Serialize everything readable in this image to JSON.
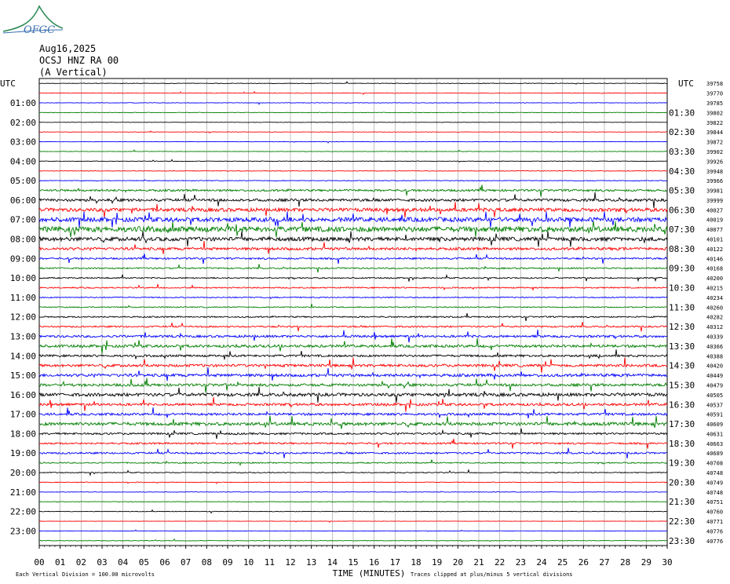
{
  "header": {
    "date": "Aug16,2025",
    "station": "OCSJ HNZ RA 00",
    "component": "(A Vertical)",
    "logo_text": "OFGC"
  },
  "axis": {
    "left_unit": "UTC",
    "right_unit": "UTC",
    "left_labels": [
      "01:00",
      "02:00",
      "03:00",
      "04:00",
      "05:00",
      "06:00",
      "07:00",
      "08:00",
      "09:00",
      "10:00",
      "11:00",
      "12:00",
      "13:00",
      "14:00",
      "15:00",
      "16:00",
      "17:00",
      "18:00",
      "19:00",
      "20:00",
      "21:00",
      "22:00",
      "23:00"
    ],
    "right_labels": [
      "01:30",
      "02:30",
      "03:30",
      "04:30",
      "05:30",
      "06:30",
      "07:30",
      "08:30",
      "09:30",
      "10:30",
      "11:30",
      "12:30",
      "13:30",
      "14:30",
      "15:30",
      "16:30",
      "17:30",
      "18:30",
      "19:30",
      "20:30",
      "21:30",
      "22:30",
      "23:30"
    ],
    "x_ticks": [
      "00",
      "01",
      "02",
      "03",
      "04",
      "05",
      "06",
      "07",
      "08",
      "09",
      "10",
      "11",
      "12",
      "13",
      "14",
      "15",
      "16",
      "17",
      "18",
      "19",
      "20",
      "21",
      "22",
      "23",
      "24",
      "25",
      "26",
      "27",
      "28",
      "29",
      "30"
    ],
    "x_title": "TIME (MINUTES)"
  },
  "footer": {
    "scale_note": "Each Vertical Division =  100.00 microvolts",
    "clip_note": "Traces clipped at plus/minus 5 vertical divisions"
  },
  "chart_data": {
    "type": "helicorder",
    "x_range_minutes": [
      0,
      30
    ],
    "trace_count": 48,
    "trace_colors": [
      "#000000",
      "#ff0000",
      "#0000ff",
      "#007f00"
    ],
    "offsets": [
      "39758",
      "39770",
      "39785",
      "39802",
      "39822",
      "39844",
      "39872",
      "39902",
      "39926",
      "39948",
      "39966",
      "39981",
      "39999",
      "40027",
      "40019",
      "40077",
      "40101",
      "40122",
      "40146",
      "40168",
      "40200",
      "40215",
      "40234",
      "40260",
      "40282",
      "40312",
      "40339",
      "40366",
      "40388",
      "40420",
      "40449",
      "40479",
      "40505",
      "40537",
      "40591",
      "40609",
      "40631",
      "40663",
      "40689",
      "40708",
      "40748",
      "40749",
      "40748",
      "40751",
      "40760",
      "40771",
      "40776",
      "40776"
    ],
    "activity_levels": [
      0.3,
      0.3,
      0.3,
      0.3,
      0.2,
      0.2,
      0.2,
      0.3,
      0.3,
      0.3,
      0.4,
      1.2,
      1.5,
      2.0,
      2.5,
      3.0,
      2.2,
      1.5,
      1.0,
      0.8,
      0.7,
      0.7,
      0.6,
      0.6,
      0.8,
      0.9,
      1.3,
      1.5,
      1.2,
      1.5,
      1.6,
      1.5,
      1.8,
      1.4,
      1.3,
      1.8,
      1.1,
      1.0,
      1.0,
      0.7,
      0.5,
      0.4,
      0.3,
      0.3,
      0.3,
      0.2,
      0.2,
      0.3
    ]
  }
}
